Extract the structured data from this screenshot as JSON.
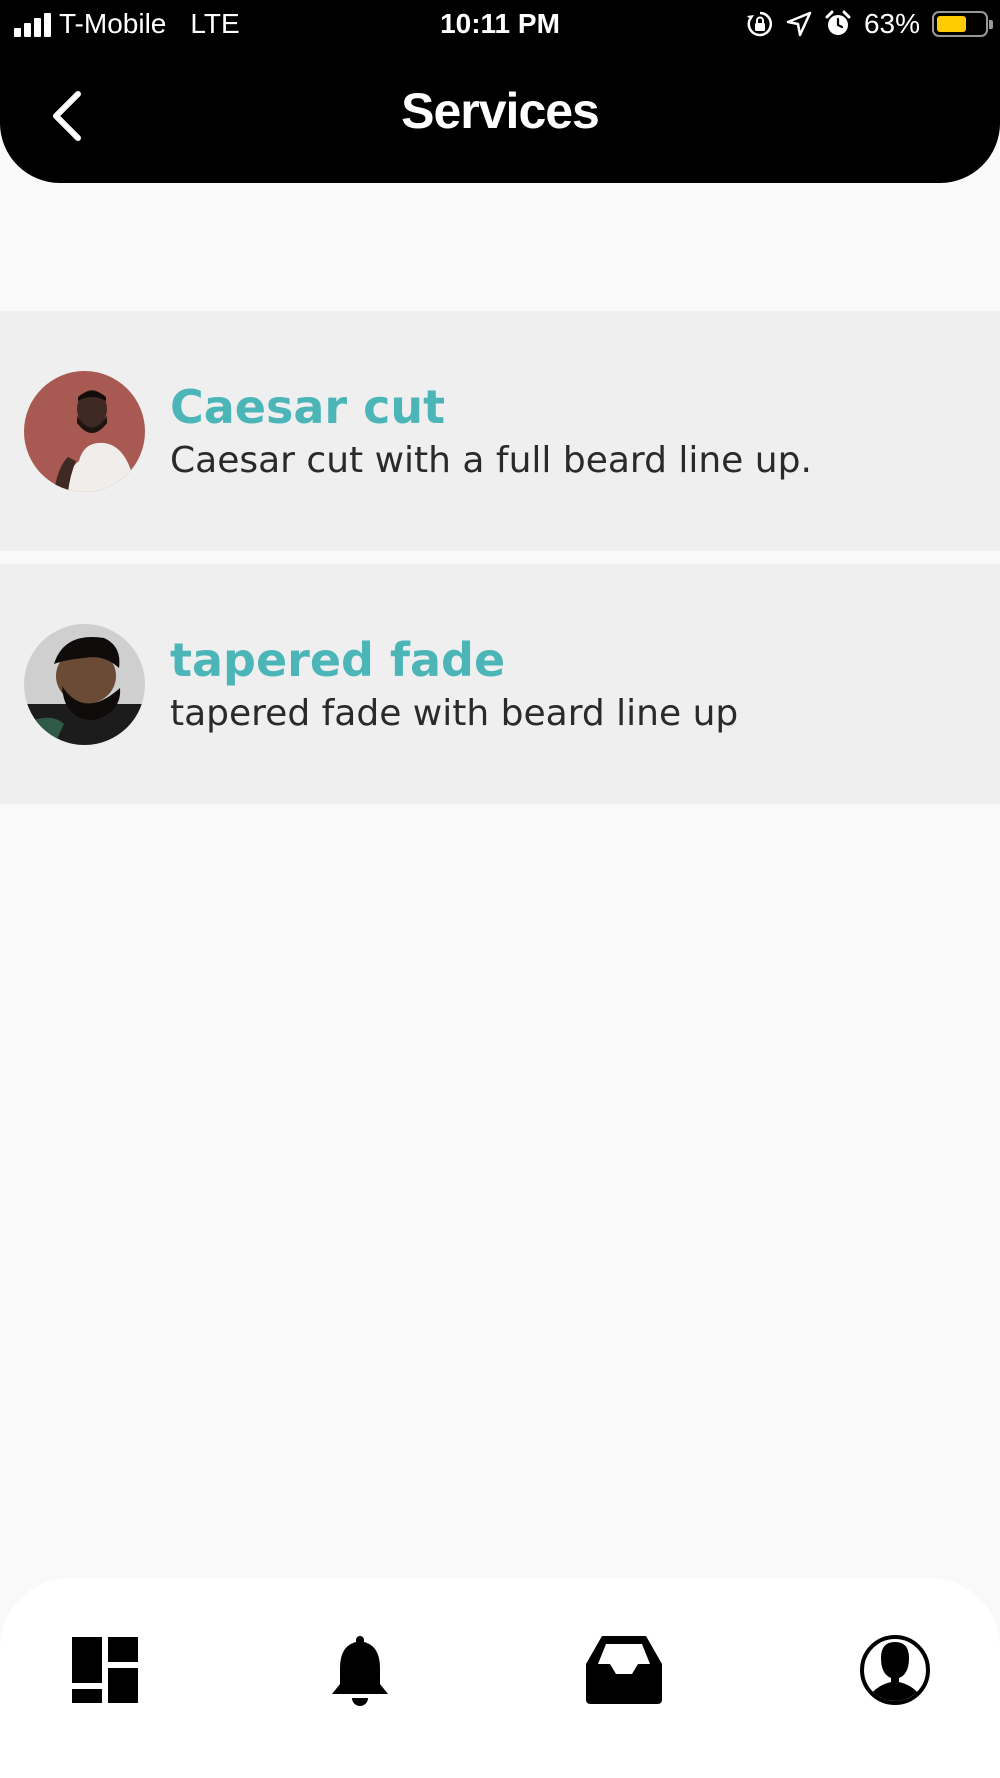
{
  "status_bar": {
    "carrier": "T-Mobile",
    "network": "LTE",
    "time": "10:11 PM",
    "battery_percent": "63%",
    "battery_level": 0.63,
    "icons": [
      "signal-icon",
      "orientation-lock-icon",
      "location-icon",
      "alarm-icon",
      "battery-icon"
    ]
  },
  "header": {
    "title": "Services",
    "back_icon": "chevron-left-icon"
  },
  "services": [
    {
      "name": "Caesar cut",
      "description": "Caesar cut with a full beard line up."
    },
    {
      "name": "tapered fade",
      "description": "tapered fade with beard line up"
    }
  ],
  "tab_bar": {
    "tabs": [
      {
        "icon": "dashboard-icon"
      },
      {
        "icon": "bell-icon"
      },
      {
        "icon": "inbox-icon"
      },
      {
        "icon": "profile-icon"
      }
    ]
  },
  "colors": {
    "accent": "#4bb5b8",
    "header_background": "#000000",
    "list_item_background": "#efefef",
    "page_background": "#f9f9f9",
    "battery_fill": "#ffcc00"
  }
}
